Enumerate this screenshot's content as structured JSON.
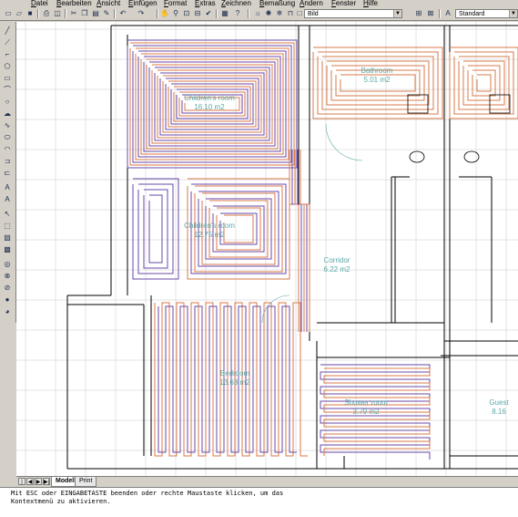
{
  "menu": {
    "items": [
      "Datei",
      "Bearbeiten",
      "Ansicht",
      "Einfügen",
      "Format",
      "Extras",
      "Zeichnen",
      "Bemaßung",
      "Ändern",
      "Fenster",
      "Hilfe"
    ]
  },
  "toolbar": {
    "layer_value": "Bild",
    "style_value": "Standard"
  },
  "drawing": {
    "rooms": [
      {
        "name": "Children's room",
        "area": "16.10 m2"
      },
      {
        "name": "Children's room",
        "area": "12.75 m2"
      },
      {
        "name": "Corridor",
        "area": "6.22 m2"
      },
      {
        "name": "Bedroom",
        "area": "13.63 m2"
      },
      {
        "name": "Guest",
        "area": "8.16"
      },
      {
        "name": "Bathroom",
        "area": "5.01 m2"
      },
      {
        "name": "Shower room",
        "area": "3.79 m2"
      }
    ]
  },
  "tabs": {
    "model": "Modell",
    "print": "Print"
  },
  "command": {
    "line1": "Mit ESC oder EINGABETASTE beenden oder rechte Maustaste klicken, um das",
    "line2": "Kontextmenü zu aktivieren."
  },
  "colors": {
    "pipe_orange": "#d87a4a",
    "pipe_purple": "#6a4aa8",
    "room_label": "#5aa8a8",
    "wall": "#000000",
    "grid": "#c8c8c8"
  }
}
